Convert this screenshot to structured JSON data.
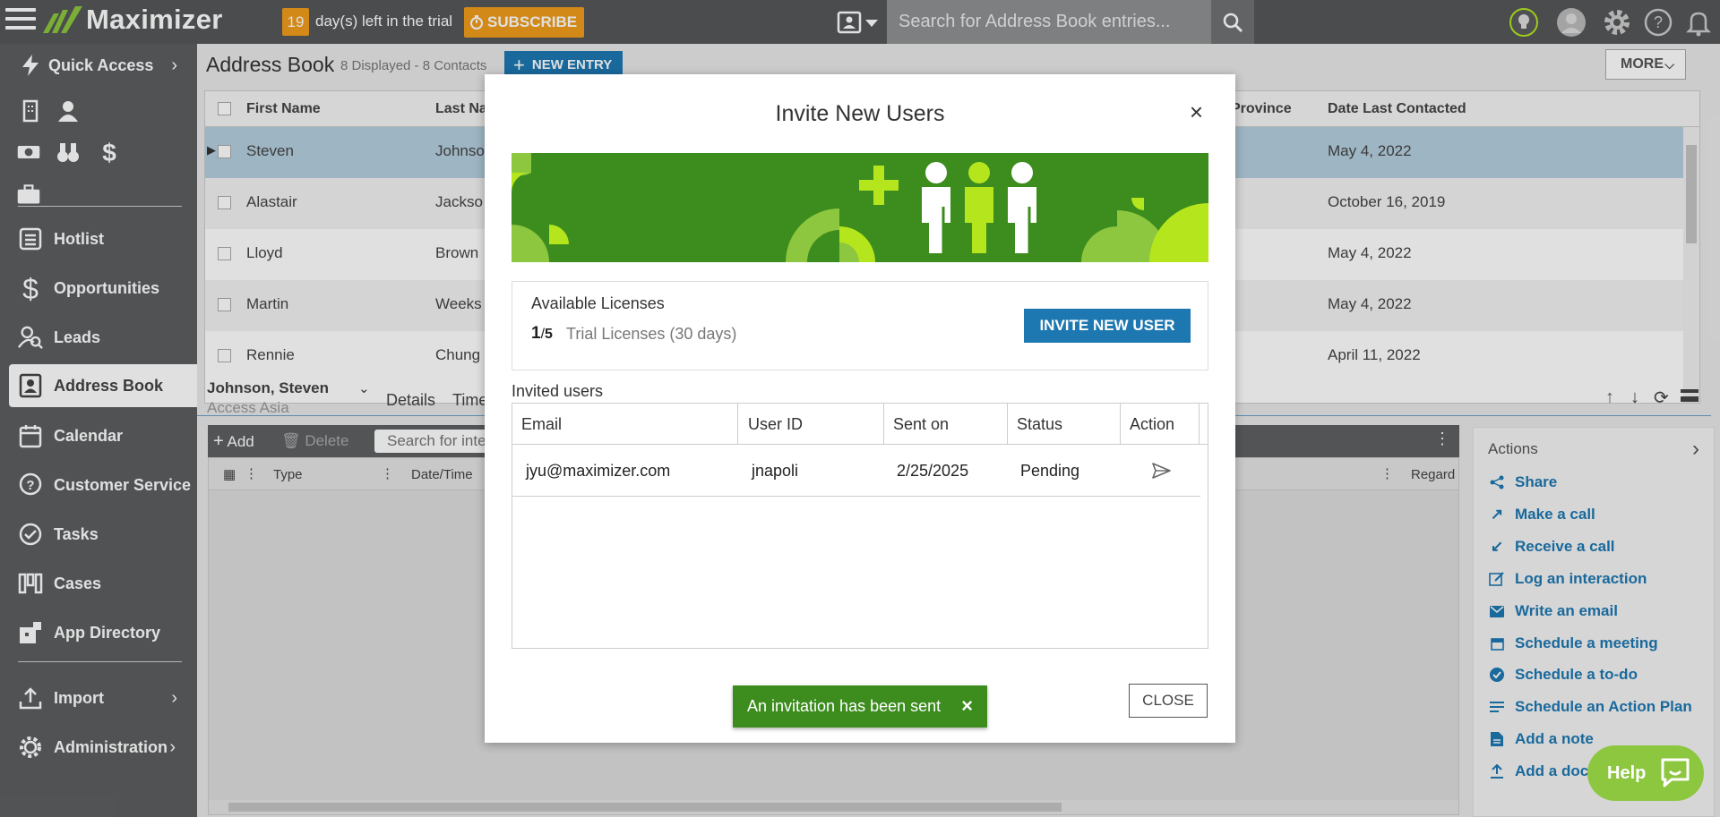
{
  "topbar": {
    "logo_text": "Maximizer",
    "trial_days": "19",
    "trial_text": "day(s) left in the trial",
    "subscribe_label": "SUBSCRIBE",
    "search_placeholder": "Search for Address Book entries..."
  },
  "sidebar": {
    "quick_access": "Quick Access",
    "items": [
      {
        "label": "Hotlist",
        "icon": "list-icon"
      },
      {
        "label": "Opportunities",
        "icon": "dollar-icon"
      },
      {
        "label": "Leads",
        "icon": "leads-icon"
      },
      {
        "label": "Address Book",
        "icon": "contact-card-icon"
      },
      {
        "label": "Calendar",
        "icon": "calendar-icon"
      },
      {
        "label": "Customer Service",
        "icon": "question-bubble-icon"
      },
      {
        "label": "Tasks",
        "icon": "check-circle-icon"
      },
      {
        "label": "Cases",
        "icon": "cases-icon"
      },
      {
        "label": "App Directory",
        "icon": "app-directory-icon"
      }
    ],
    "import": "Import",
    "administration": "Administration"
  },
  "address_book": {
    "title": "Address Book",
    "count": "8 Displayed - 8 Contacts",
    "new_entry": "NEW ENTRY",
    "more": "MORE",
    "columns": [
      "First Name",
      "Last Na",
      "Province",
      "Date Last Contacted"
    ],
    "rows": [
      {
        "first": "Steven",
        "last": "Johnso",
        "date": "May 4, 2022"
      },
      {
        "first": "Alastair",
        "last": "Jackso",
        "date": "October 16, 2019"
      },
      {
        "first": "Lloyd",
        "last": "Brown",
        "date": "May 4, 2022"
      },
      {
        "first": "Martin",
        "last": "Weeks",
        "date": "May 4, 2022"
      },
      {
        "first": "Rennie",
        "last": "Chung",
        "date": "April 11, 2022"
      }
    ]
  },
  "detail": {
    "name": "Johnson, Steven",
    "company": "Access Asia",
    "tabs": [
      "Details",
      "Time"
    ],
    "toolbar": {
      "add": "Add",
      "delete": "Delete",
      "search_placeholder": "Search for inte"
    },
    "columns": [
      "Type",
      "Date/Time",
      "Regard"
    ]
  },
  "actions": {
    "title": "Actions",
    "items": [
      "Share",
      "Make a call",
      "Receive a call",
      "Log an interaction",
      "Write an email",
      "Schedule a meeting",
      "Schedule a to-do",
      "Schedule an Action Plan",
      "Add a note",
      "Add a doc"
    ]
  },
  "help_label": "Help",
  "modal": {
    "title": "Invite New Users",
    "licenses_title": "Available Licenses",
    "licenses_used": "1",
    "licenses_total": "5",
    "licenses_desc": "Trial Licenses (30 days)",
    "invite_button": "INVITE NEW USER",
    "invited_label": "Invited users",
    "columns": [
      "Email",
      "User ID",
      "Sent on",
      "Status",
      "Action"
    ],
    "rows": [
      {
        "email": "jyu@maximizer.com",
        "user_id": "jnapoli",
        "sent_on": "2/25/2025",
        "status": "Pending"
      }
    ],
    "toast": "An invitation has been sent",
    "close_button": "CLOSE"
  },
  "colors": {
    "brand_green": "#3c8c1e",
    "accent_blue": "#1d78b2",
    "trial_orange": "#f09c1b",
    "lime": "#b5e61d"
  }
}
